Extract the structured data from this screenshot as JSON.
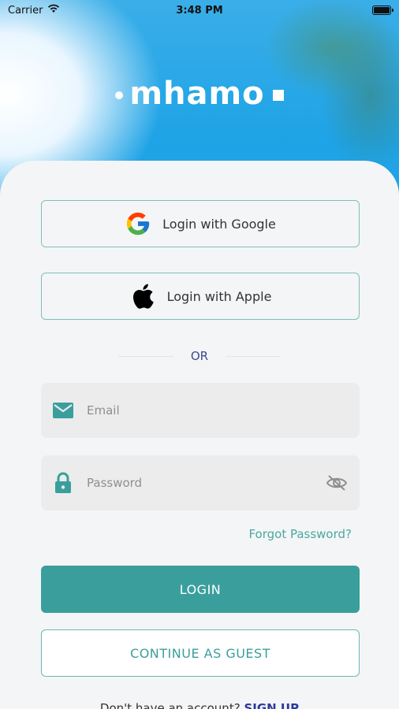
{
  "status_bar": {
    "carrier": "Carrier",
    "time": "3:48 PM"
  },
  "brand": {
    "logo_text": "mhamo"
  },
  "social": {
    "google_label": "Login with Google",
    "apple_label": "Login with Apple"
  },
  "divider": {
    "or_text": "OR"
  },
  "form": {
    "email_placeholder": "Email",
    "email_value": "",
    "password_placeholder": "Password",
    "password_value": "",
    "forgot_label": "Forgot Password?"
  },
  "actions": {
    "login_label": "LOGIN",
    "guest_label": "CONTINUE AS GUEST"
  },
  "footer": {
    "prompt_text": "Don't have an account?",
    "signup_label": "SIGN UP"
  },
  "colors": {
    "accent": "#3a9f9c",
    "sky": "#1ea3e6",
    "link_blue": "#2b3a9a"
  },
  "icons": {
    "wifi": "wifi-icon",
    "battery": "battery-icon",
    "google": "google-icon",
    "apple": "apple-icon",
    "email": "mail-icon",
    "password": "lock-icon",
    "visibility": "eye-off-icon"
  }
}
